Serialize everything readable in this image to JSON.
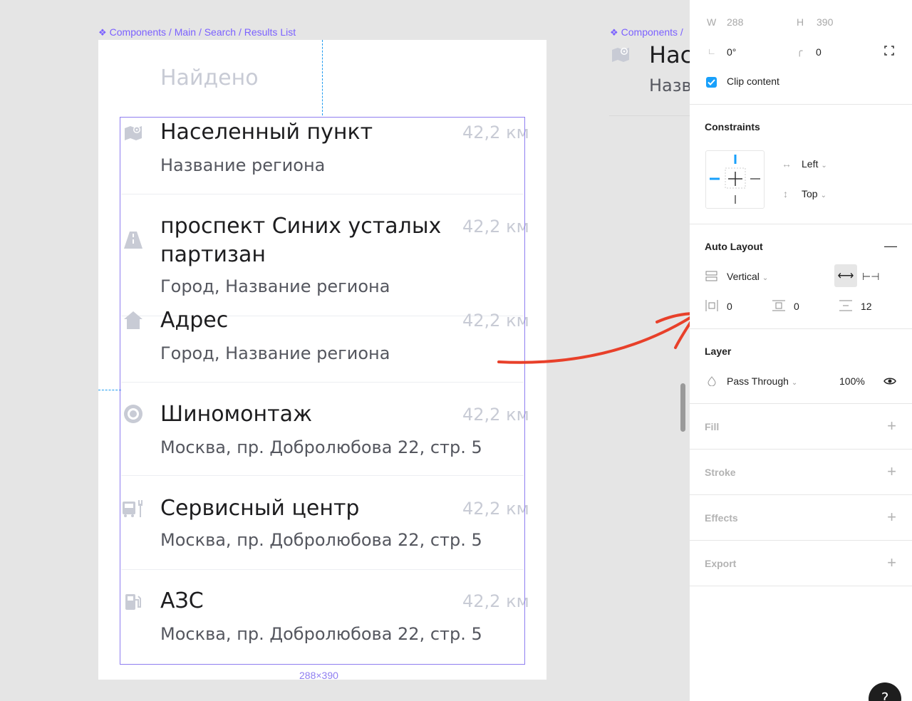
{
  "canvas": {
    "breadcrumb_left": "Components / Main / Search / Results List",
    "breadcrumb_right": "Components /",
    "found_heading": "Найдено",
    "size_label": "288×390",
    "ghost_title": "Нас",
    "ghost_subtitle": "Назв",
    "results": [
      {
        "icon": "map-pin-icon",
        "title": "Населенный пункт",
        "subtitle": "Название региона",
        "distance": "42,2 км"
      },
      {
        "icon": "road-icon",
        "title": "проспект Синих усталых партизан",
        "subtitle": "Город, Название региона",
        "distance": "42,2 км"
      },
      {
        "icon": "home-icon",
        "title": "Адрес",
        "subtitle": "Город, Название региона",
        "distance": "42,2 км"
      },
      {
        "icon": "tire-icon",
        "title": "Шиномонтаж",
        "subtitle": "Москва, пр. Добролюбова 22, стр. 5",
        "distance": "42,2 км"
      },
      {
        "icon": "car-service-icon",
        "title": "Сервисный центр",
        "subtitle": "Москва, пр. Добролюбова 22, стр. 5",
        "distance": "42,2 км"
      },
      {
        "icon": "fuel-icon",
        "title": "АЗС",
        "subtitle": "Москва, пр. Добролюбова 22, стр. 5",
        "distance": "42,2 км"
      }
    ]
  },
  "panel": {
    "w_label": "W",
    "w_value": "288",
    "h_label": "H",
    "h_value": "390",
    "rotation": "0°",
    "radius": "0",
    "clip_content": "Clip content",
    "constraints_title": "Constraints",
    "constraint_h": "Left",
    "constraint_v": "Top",
    "auto_layout_title": "Auto Layout",
    "direction": "Vertical",
    "padding_h": "0",
    "padding_v": "0",
    "spacing": "12",
    "layer_title": "Layer",
    "blend_mode": "Pass Through",
    "opacity": "100%",
    "fill_title": "Fill",
    "stroke_title": "Stroke",
    "effects_title": "Effects",
    "export_title": "Export",
    "help_label": "?"
  },
  "colors": {
    "selection": "#8f7ef0",
    "accent": "#18a0fb",
    "arrow": "#e8402a",
    "icon": "#c8cbd5"
  }
}
